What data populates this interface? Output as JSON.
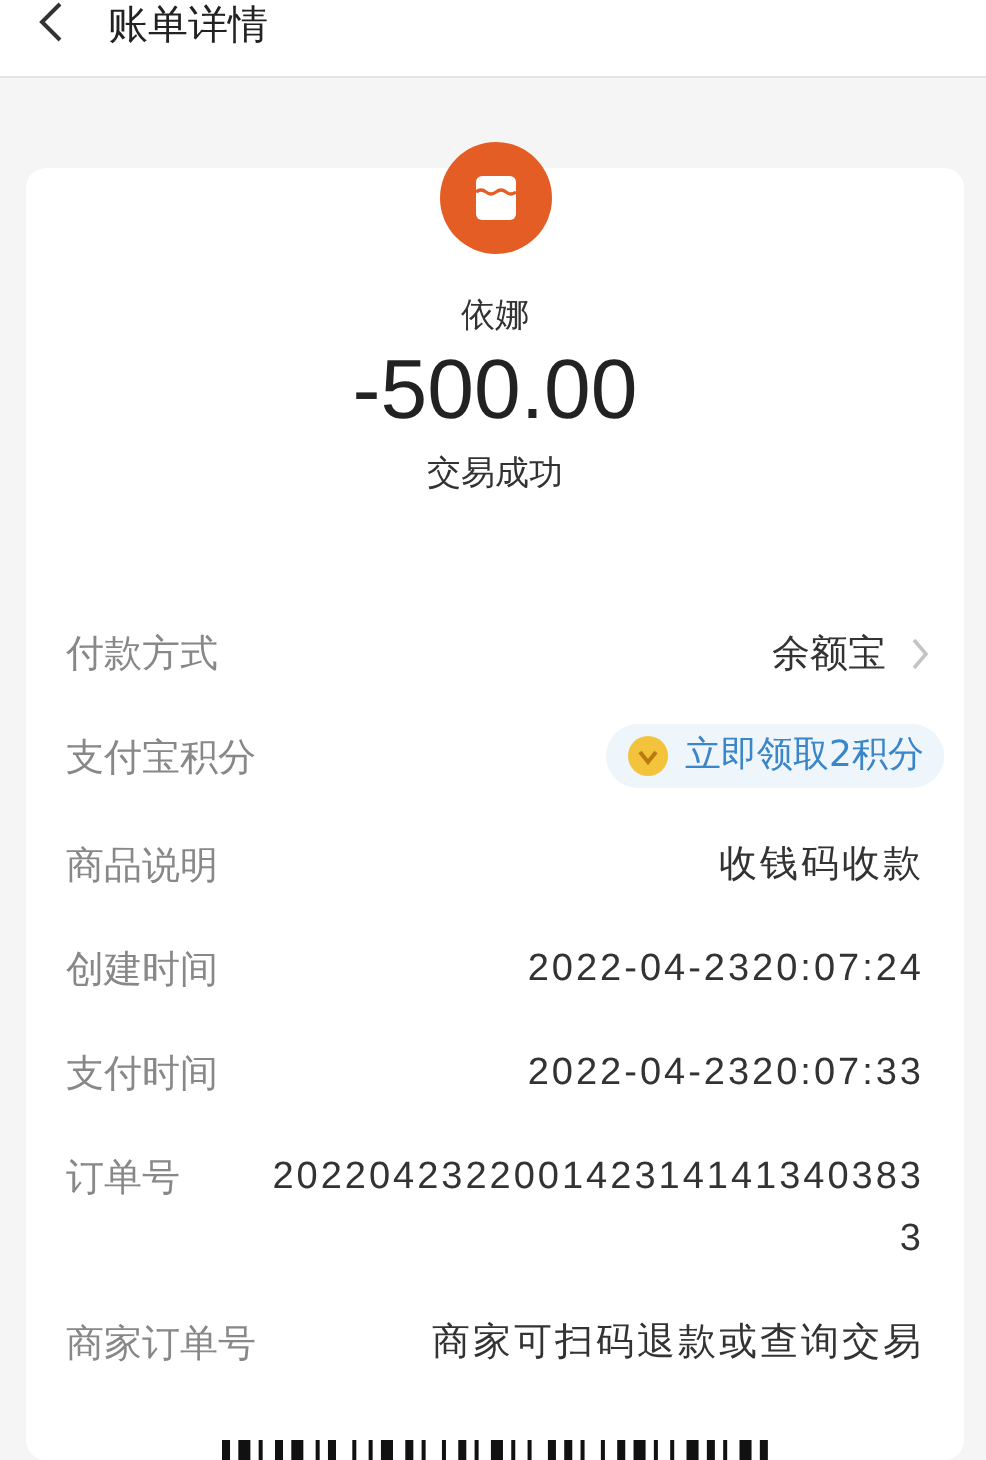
{
  "header": {
    "title": "账单详情"
  },
  "merchant": {
    "name": "依娜",
    "amount": "-500.00",
    "status": "交易成功"
  },
  "rows": [
    {
      "kind": "link",
      "label": "付款方式",
      "value": "余额宝"
    },
    {
      "kind": "points",
      "label": "支付宝积分",
      "value": "立即领取2积分"
    },
    {
      "kind": "plain",
      "label": "商品说明",
      "value": "收钱码收款"
    },
    {
      "kind": "plain",
      "label": "创建时间",
      "value": "2022-04-2320:07:24"
    },
    {
      "kind": "plain",
      "label": "支付时间",
      "value": "2022-04-2320:07:33"
    },
    {
      "kind": "plain",
      "label": "订单号",
      "value": "2022042322001423141413403833"
    },
    {
      "kind": "plain",
      "label": "商家订单号",
      "value": "商家可扫码退款或查询交易"
    }
  ]
}
